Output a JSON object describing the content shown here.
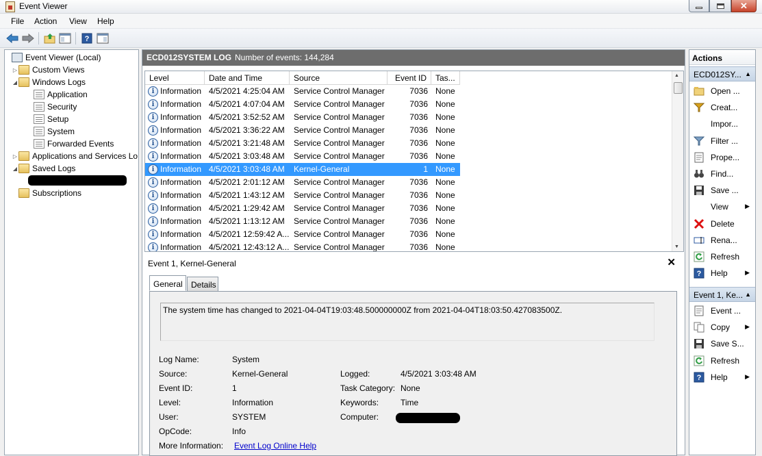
{
  "window": {
    "title": "Event Viewer"
  },
  "menu": [
    "File",
    "Action",
    "View",
    "Help"
  ],
  "tree": [
    {
      "label": "Event Viewer (Local)",
      "level": 0,
      "icon": "computer-icon",
      "arrow": ""
    },
    {
      "label": "Custom Views",
      "level": 1,
      "icon": "folder-icon",
      "arrow": "▷"
    },
    {
      "label": "Windows Logs",
      "level": 1,
      "icon": "folder-icon",
      "arrow": "◢"
    },
    {
      "label": "Application",
      "level": 2,
      "icon": "log-icon",
      "arrow": ""
    },
    {
      "label": "Security",
      "level": 2,
      "icon": "log-icon",
      "arrow": ""
    },
    {
      "label": "Setup",
      "level": 2,
      "icon": "log-icon",
      "arrow": ""
    },
    {
      "label": "System",
      "level": 2,
      "icon": "log-icon",
      "arrow": ""
    },
    {
      "label": "Forwarded Events",
      "level": 2,
      "icon": "log-icon",
      "arrow": ""
    },
    {
      "label": "Applications and Services Lo",
      "level": 1,
      "icon": "folder-icon",
      "arrow": "▷"
    },
    {
      "label": "Saved Logs",
      "level": 1,
      "icon": "folder-icon",
      "arrow": "◢"
    },
    {
      "label": "",
      "level": 2,
      "icon": "",
      "arrow": "",
      "redacted": true
    },
    {
      "label": "Subscriptions",
      "level": 1,
      "icon": "folder-icon",
      "arrow": ""
    }
  ],
  "center": {
    "log_name": "ECD012SYSTEM LOG",
    "event_count": "Number of events: 144,284",
    "columns": [
      "Level",
      "Date and Time",
      "Source",
      "Event ID",
      "Tas..."
    ],
    "rows": [
      {
        "level": "Information",
        "datetime": "4/5/2021 4:25:04 AM",
        "source": "Service Control Manager",
        "event_id": "7036",
        "task": "None",
        "selected": false
      },
      {
        "level": "Information",
        "datetime": "4/5/2021 4:07:04 AM",
        "source": "Service Control Manager",
        "event_id": "7036",
        "task": "None",
        "selected": false
      },
      {
        "level": "Information",
        "datetime": "4/5/2021 3:52:52 AM",
        "source": "Service Control Manager",
        "event_id": "7036",
        "task": "None",
        "selected": false
      },
      {
        "level": "Information",
        "datetime": "4/5/2021 3:36:22 AM",
        "source": "Service Control Manager",
        "event_id": "7036",
        "task": "None",
        "selected": false
      },
      {
        "level": "Information",
        "datetime": "4/5/2021 3:21:48 AM",
        "source": "Service Control Manager",
        "event_id": "7036",
        "task": "None",
        "selected": false
      },
      {
        "level": "Information",
        "datetime": "4/5/2021 3:03:48 AM",
        "source": "Service Control Manager",
        "event_id": "7036",
        "task": "None",
        "selected": false
      },
      {
        "level": "Information",
        "datetime": "4/5/2021 3:03:48 AM",
        "source": "Kernel-General",
        "event_id": "1",
        "task": "None",
        "selected": true
      },
      {
        "level": "Information",
        "datetime": "4/5/2021 2:01:12 AM",
        "source": "Service Control Manager",
        "event_id": "7036",
        "task": "None",
        "selected": false
      },
      {
        "level": "Information",
        "datetime": "4/5/2021 1:43:12 AM",
        "source": "Service Control Manager",
        "event_id": "7036",
        "task": "None",
        "selected": false
      },
      {
        "level": "Information",
        "datetime": "4/5/2021 1:29:42 AM",
        "source": "Service Control Manager",
        "event_id": "7036",
        "task": "None",
        "selected": false
      },
      {
        "level": "Information",
        "datetime": "4/5/2021 1:13:12 AM",
        "source": "Service Control Manager",
        "event_id": "7036",
        "task": "None",
        "selected": false
      },
      {
        "level": "Information",
        "datetime": "4/5/2021 12:59:42 A...",
        "source": "Service Control Manager",
        "event_id": "7036",
        "task": "None",
        "selected": false
      },
      {
        "level": "Information",
        "datetime": "4/5/2021 12:43:12 A...",
        "source": "Service Control Manager",
        "event_id": "7036",
        "task": "None",
        "selected": false
      }
    ]
  },
  "detail": {
    "title": "Event 1, Kernel-General",
    "tabs": [
      "General",
      "Details"
    ],
    "description": "The system time has changed to 2021-04-04T19:03:48.500000000Z from 2021-04-04T18:03:50.427083500Z.",
    "log_name_label": "Log Name:",
    "log_name": "System",
    "source_label": "Source:",
    "source": "Kernel-General",
    "logged_label": "Logged:",
    "logged": "4/5/2021 3:03:48 AM",
    "event_id_label": "Event ID:",
    "event_id": "1",
    "task_category_label": "Task Category:",
    "task_category": "None",
    "level_label": "Level:",
    "level": "Information",
    "keywords_label": "Keywords:",
    "keywords": "Time",
    "user_label": "User:",
    "user": "SYSTEM",
    "computer_label": "Computer:",
    "opcode_label": "OpCode:",
    "opcode": "Info",
    "more_info_label": "More Information:",
    "more_info_link": "Event Log Online Help"
  },
  "actions": {
    "title": "Actions",
    "section1": "ECD012SY...",
    "section1_items": [
      {
        "label": "Open ...",
        "icon": "open-folder-icon",
        "submenu": false
      },
      {
        "label": "Creat...",
        "icon": "filter-funnel-icon",
        "submenu": false
      },
      {
        "label": "Impor...",
        "icon": "",
        "submenu": false
      },
      {
        "label": "Filter ...",
        "icon": "filter-icon",
        "submenu": false
      },
      {
        "label": "Prope...",
        "icon": "properties-icon",
        "submenu": false
      },
      {
        "label": "Find...",
        "icon": "binoculars-icon",
        "submenu": false
      },
      {
        "label": "Save ...",
        "icon": "save-icon",
        "submenu": false
      },
      {
        "label": "View",
        "icon": "",
        "submenu": true
      },
      {
        "label": "Delete",
        "icon": "delete-icon",
        "submenu": false
      },
      {
        "label": "Rena...",
        "icon": "rename-icon",
        "submenu": false
      },
      {
        "label": "Refresh",
        "icon": "refresh-icon",
        "submenu": false
      },
      {
        "label": "Help",
        "icon": "help-icon",
        "submenu": true
      }
    ],
    "section2": "Event 1, Ke...",
    "section2_items": [
      {
        "label": "Event ...",
        "icon": "event-properties-icon",
        "submenu": false
      },
      {
        "label": "Copy",
        "icon": "copy-icon",
        "submenu": true
      },
      {
        "label": "Save S...",
        "icon": "save-icon",
        "submenu": false
      },
      {
        "label": "Refresh",
        "icon": "refresh-icon",
        "submenu": false
      },
      {
        "label": "Help",
        "icon": "help-icon",
        "submenu": true
      }
    ]
  },
  "colors": {
    "selection": "#3399ff",
    "header_bar": "#6d6d6d",
    "link": "#0000cc",
    "section_bg": "#c6d5e6"
  }
}
